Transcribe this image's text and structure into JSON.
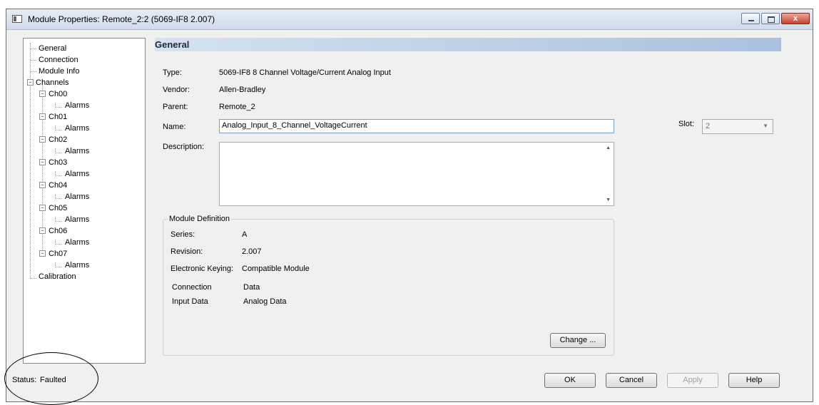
{
  "window": {
    "title": "Module Properties: Remote_2:2 (5069-IF8 2.007)",
    "close_symbol": "x"
  },
  "tree": {
    "items": [
      {
        "label": "General"
      },
      {
        "label": "Connection"
      },
      {
        "label": "Module Info"
      },
      {
        "label": "Channels"
      },
      {
        "label": "Ch00"
      },
      {
        "label": "Alarms"
      },
      {
        "label": "Ch01"
      },
      {
        "label": "Alarms"
      },
      {
        "label": "Ch02"
      },
      {
        "label": "Alarms"
      },
      {
        "label": "Ch03"
      },
      {
        "label": "Alarms"
      },
      {
        "label": "Ch04"
      },
      {
        "label": "Alarms"
      },
      {
        "label": "Ch05"
      },
      {
        "label": "Alarms"
      },
      {
        "label": "Ch06"
      },
      {
        "label": "Alarms"
      },
      {
        "label": "Ch07"
      },
      {
        "label": "Alarms"
      },
      {
        "label": "Calibration"
      }
    ]
  },
  "page": {
    "header": "General",
    "type_label": "Type:",
    "type_value": "5069-IF8 8 Channel Voltage/Current Analog Input",
    "vendor_label": "Vendor:",
    "vendor_value": "Allen-Bradley",
    "parent_label": "Parent:",
    "parent_value": "Remote_2",
    "name_label": "Name:",
    "name_value": "Analog_Input_8_Channel_VoltageCurrent",
    "description_label": "Description:",
    "description_value": "",
    "slot_label": "Slot:",
    "slot_value": "2"
  },
  "module_definition": {
    "title": "Module Definition",
    "series_label": "Series:",
    "series_value": "A",
    "revision_label": "Revision:",
    "revision_value": "2.007",
    "keying_label": "Electronic Keying:",
    "keying_value": "Compatible Module",
    "connection_label": "Connection",
    "connection_value": "Data",
    "input_label": "Input Data",
    "input_value": "Analog Data",
    "change_button": "Change ..."
  },
  "footer": {
    "status_label": "Status:",
    "status_value": "Faulted",
    "ok": "OK",
    "cancel": "Cancel",
    "apply": "Apply",
    "help": "Help"
  },
  "colors": {
    "header_band_start": "#d6e2f0",
    "header_band_end": "#a9c1de",
    "dialog_bg": "#f0f0f0"
  }
}
